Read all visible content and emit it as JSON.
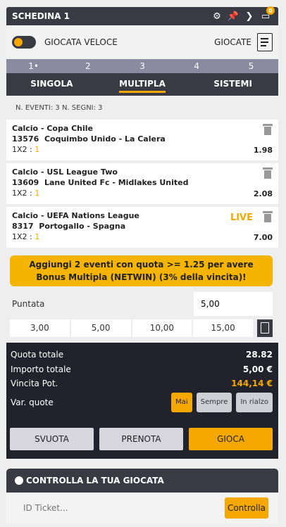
{
  "header": {
    "title": "SCHEDINA 1",
    "badge_count": "0"
  },
  "fast": {
    "label": "GIOCATA VELOCE",
    "giocate_label": "GIOCATE"
  },
  "steps": [
    "1•",
    "2",
    "3",
    "4",
    "5"
  ],
  "tabs": [
    "SINGOLA",
    "MULTIPLA",
    "SISTEMI"
  ],
  "counts": "N. EVENTI: 3  N. SEGNI: 3",
  "events": [
    {
      "sport": "Calcio - Copa Chile",
      "code": "13576",
      "match": "Coquimbo Unido  -  La Calera",
      "market": "1X2 : ",
      "pick": "1",
      "odd": "1.98"
    },
    {
      "sport": "Calcio - USL League Two",
      "code": "13609",
      "match": "Lane United Fc  -  Midlakes United",
      "market": "1X2 : ",
      "pick": "1",
      "odd": "2.08"
    },
    {
      "sport": "Calcio - UEFA Nations League",
      "code": "8317",
      "match": "Portogallo  -  Spagna",
      "market": "1X2 : ",
      "pick": "1",
      "odd": "7.00",
      "live": "LIVE"
    }
  ],
  "bonus": {
    "line1": "Aggiungi 2 eventi con quota >= 1.25 per avere",
    "line2": "Bonus Multipla (NETWIN) (3% della vincita)!"
  },
  "puntata": {
    "label": "Puntata",
    "value": "5,00"
  },
  "quick_amounts": [
    "3,00",
    "5,00",
    "10,00",
    "15,00"
  ],
  "summary": {
    "quota_label": "Quota totale",
    "quota_value": "28.82",
    "importo_label": "Importo totale",
    "importo_value": "5,00 €",
    "vincita_label": "Vincita Pot.",
    "vincita_value": "144,14 €",
    "var_label": "Var. quote",
    "var_options": [
      "Mai",
      "Sempre",
      "In rialzo"
    ]
  },
  "actions": {
    "svuota": "SVUOTA",
    "prenota": "PRENOTA",
    "gioca": "GIOCA"
  },
  "check": {
    "title": "CONTROLLA LA TUA GIOCATA",
    "placeholder": "ID Ticket...",
    "button": "Controlla"
  },
  "colors": {
    "accent": "#f5a800",
    "dark": "#3a3a44",
    "panel": "#22222c"
  }
}
